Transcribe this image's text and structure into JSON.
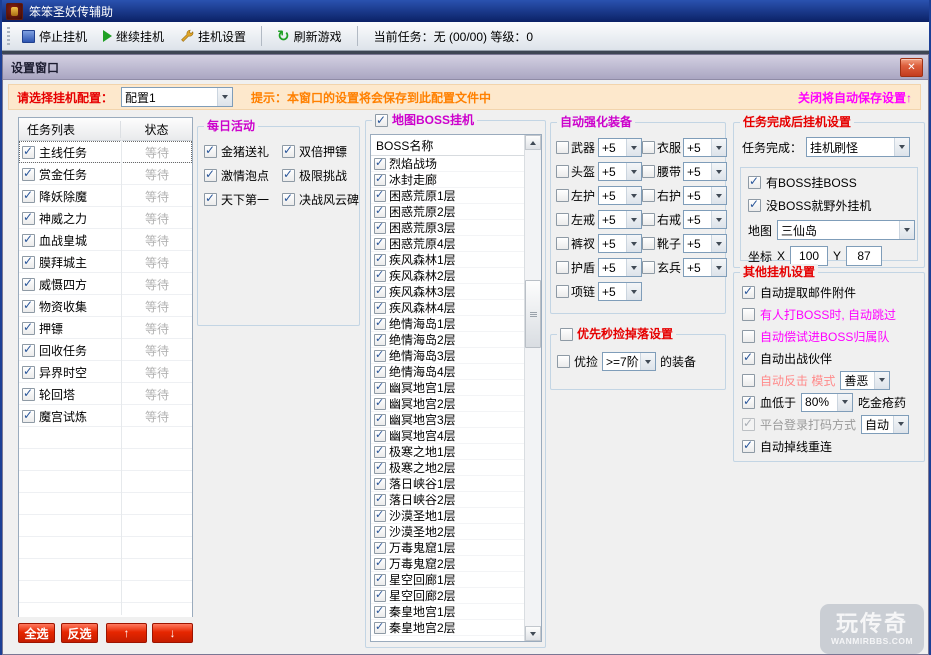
{
  "window": {
    "title": "笨笨圣妖传辅助"
  },
  "toolbar": {
    "stop": "停止挂机",
    "continue": "继续挂机",
    "settings": "挂机设置",
    "refresh": "刷新游戏",
    "status": "当前任务：无 (00/00)  等级：0"
  },
  "dialog": {
    "title": "设置窗口",
    "close_glyph": "✕"
  },
  "config_bar": {
    "label": "请选择挂机配置：",
    "value": "配置1",
    "hint": "提示：本窗口的设置将会保存到此配置文件中",
    "autosave": "关闭将自动保存设置↑"
  },
  "tasks": {
    "col_task": "任务列表",
    "col_status": "状态",
    "all_checked": true,
    "items": [
      {
        "label": "主线任务",
        "status": "等待"
      },
      {
        "label": "赏金任务",
        "status": "等待"
      },
      {
        "label": "降妖除魔",
        "status": "等待"
      },
      {
        "label": "神威之力",
        "status": "等待"
      },
      {
        "label": "血战皇城",
        "status": "等待"
      },
      {
        "label": "膜拜城主",
        "status": "等待"
      },
      {
        "label": "威慑四方",
        "status": "等待"
      },
      {
        "label": "物资收集",
        "status": "等待"
      },
      {
        "label": "押镖",
        "status": "等待"
      },
      {
        "label": "回收任务",
        "status": "等待"
      },
      {
        "label": "异界时空",
        "status": "等待"
      },
      {
        "label": "轮回塔",
        "status": "等待"
      },
      {
        "label": "魔宫试炼",
        "status": "等待"
      }
    ],
    "buttons": {
      "select_all": "全选",
      "invert": "反选",
      "up": "↑",
      "down": "↓"
    }
  },
  "daily": {
    "title": "每日活动",
    "all_checked": true,
    "items": [
      "金猪送礼",
      "双倍押镖",
      "激情泡点",
      "极限挑战",
      "天下第一",
      "决战风云碑"
    ]
  },
  "boss": {
    "title": "地图BOSS挂机",
    "checked": true,
    "all_checked": true,
    "header": "BOSS名称",
    "items": [
      "烈焰战场",
      "冰封走廊",
      "困惑荒原1层",
      "困惑荒原2层",
      "困惑荒原3层",
      "困惑荒原4层",
      "疾风森林1层",
      "疾风森林2层",
      "疾风森林3层",
      "疾风森林4层",
      "绝情海岛1层",
      "绝情海岛2层",
      "绝情海岛3层",
      "绝情海岛4层",
      "幽冥地宫1层",
      "幽冥地宫2层",
      "幽冥地宫3层",
      "幽冥地宫4层",
      "极寒之地1层",
      "极寒之地2层",
      "落日峡谷1层",
      "落日峡谷2层",
      "沙漠圣地1层",
      "沙漠圣地2层",
      "万毒鬼窟1层",
      "万毒鬼窟2层",
      "星空回廊1层",
      "星空回廊2层",
      "秦皇地宫1层",
      "秦皇地宫2层"
    ]
  },
  "enhance": {
    "title": "自动强化装备",
    "all_checked": false,
    "items": [
      {
        "label": "武器",
        "value": "+5"
      },
      {
        "label": "衣服",
        "value": "+5"
      },
      {
        "label": "头盔",
        "value": "+5"
      },
      {
        "label": "腰带",
        "value": "+5"
      },
      {
        "label": "左护",
        "value": "+5"
      },
      {
        "label": "右护",
        "value": "+5"
      },
      {
        "label": "左戒",
        "value": "+5"
      },
      {
        "label": "右戒",
        "value": "+5"
      },
      {
        "label": "裤衩",
        "value": "+5"
      },
      {
        "label": "靴子",
        "value": "+5"
      },
      {
        "label": "护盾",
        "value": "+5"
      },
      {
        "label": "玄兵",
        "value": "+5"
      },
      {
        "label": "项链",
        "value": "+5"
      }
    ]
  },
  "pickup": {
    "title": "优先秒捡掉落设置",
    "checked": false,
    "row": {
      "checked": false,
      "prefix": "优捡",
      "value": ">=7阶",
      "suffix": "的装备"
    }
  },
  "after_task": {
    "title": "任务完成后挂机设置",
    "complete_label": "任务完成：",
    "complete_value": "挂机刷怪",
    "boss_opt": {
      "label": "有BOSS挂BOSS",
      "checked": true
    },
    "field_opt": {
      "label": "没BOSS就野外挂机",
      "checked": true
    },
    "map_label": "地图",
    "map_value": "三仙岛",
    "coord_label": "坐标",
    "x_label": "X",
    "x": "100",
    "y_label": "Y",
    "y": "87"
  },
  "other": {
    "title": "其他挂机设置",
    "items": [
      {
        "label": "自动提取邮件附件",
        "checked": true,
        "style": "color:#000000"
      },
      {
        "label": "有人打BOSS时, 自动跳过",
        "checked": false,
        "style": "color:#ff00ff"
      },
      {
        "label": "自动偿试进BOSS归属队",
        "checked": false,
        "style": "color:#ff00ff"
      },
      {
        "label": "自动出战伙伴",
        "checked": true,
        "style": "color:#000000"
      },
      {
        "label": "自动反击 模式",
        "checked": false,
        "style": "color:#ff8a8a",
        "value": "善恶"
      },
      {
        "label": "血低于",
        "value": "80%",
        "suffix": "吃金疮药",
        "checked": true,
        "style": "color:#000000"
      },
      {
        "label": "平台登录打码方式",
        "checked": true,
        "disabled": true,
        "value": "自动",
        "style": "color:#9a9a9a"
      },
      {
        "label": "自动掉线重连",
        "checked": true,
        "style": "color:#000000"
      }
    ]
  },
  "watermark": {
    "line1": "玩传奇",
    "line2": "WANMIRBBS.COM"
  },
  "colors": {
    "accent_red": "#e60000",
    "accent_magenta": "#cc00cc",
    "hint_orange": "#ff8000",
    "autosave_magenta": "#ff00ff"
  }
}
